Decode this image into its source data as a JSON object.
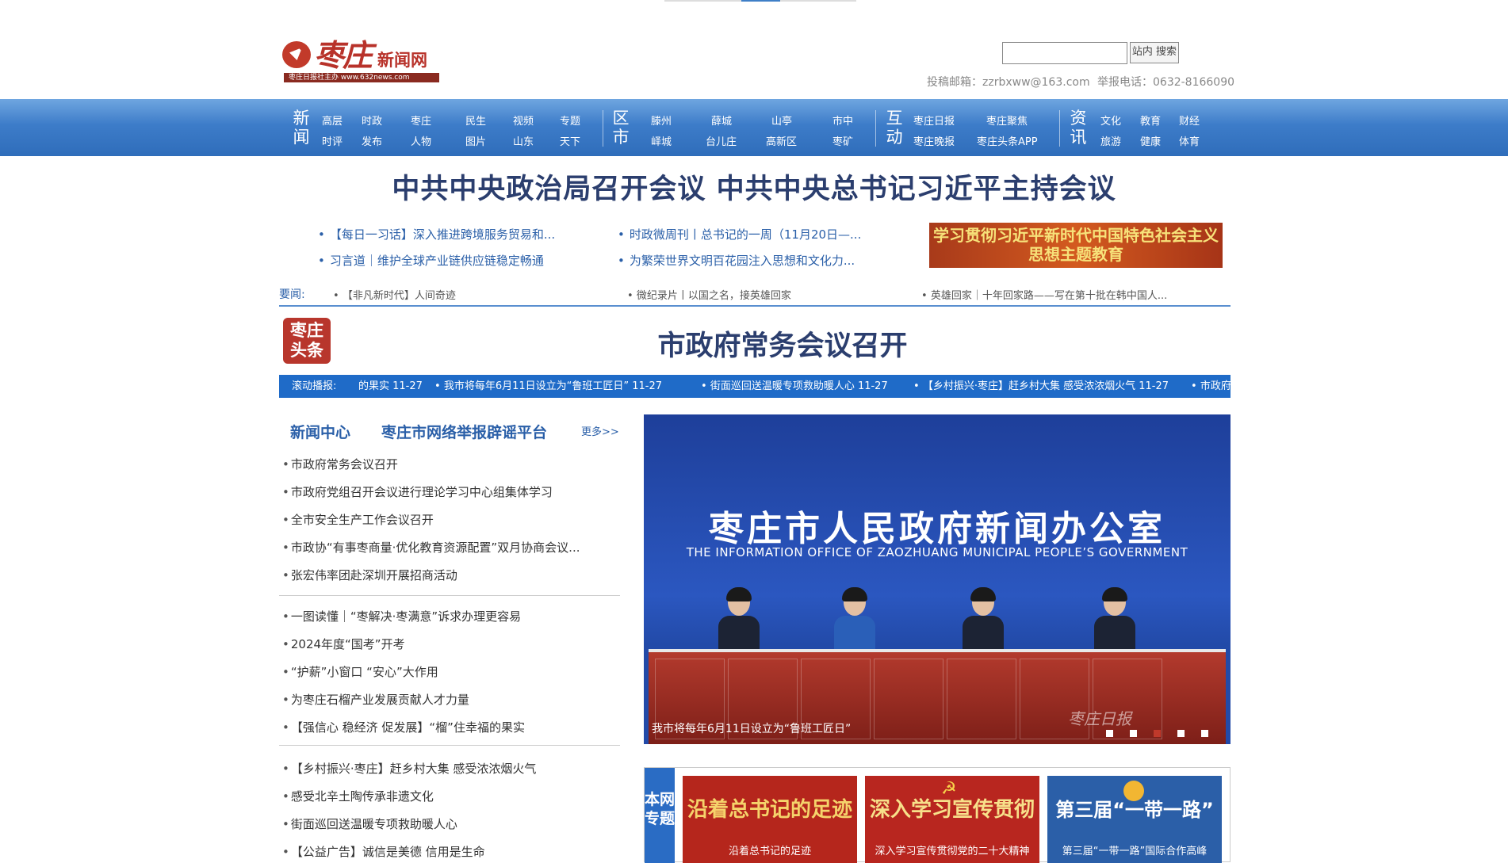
{
  "header": {
    "logo_name": "枣庄",
    "logo_subtitle": "新闻网",
    "logo_tagline": "枣庄日报社主办  www.632news.com",
    "search_button": "站内 搜索",
    "search_value": "",
    "email_text": "投稿邮箱：zzrbxww@163.com",
    "phone_text": "举报电话：0632-8166090"
  },
  "nav": {
    "groups": [
      {
        "big": "新闻",
        "items": [
          "高层",
          "时政",
          "枣庄",
          "民生",
          "视频",
          "专题",
          "时评",
          "发布",
          "人物",
          "图片",
          "山东",
          "天下"
        ]
      },
      {
        "big": "区市",
        "items": [
          "滕州",
          "薛城",
          "山亭",
          "市中",
          "峄城",
          "台儿庄",
          "高新区",
          "枣矿"
        ]
      },
      {
        "big": "互动",
        "items": [
          "枣庄日报",
          "枣庄聚焦",
          "枣庄晚报",
          "枣庄头条APP"
        ]
      },
      {
        "big": "资讯",
        "items": [
          "文化",
          "教育",
          "财经",
          "旅游",
          "健康",
          "体育"
        ]
      }
    ]
  },
  "headline": "中共中央政治局召开会议 中共中央总书记习近平主持会议",
  "sublinks": [
    "【每日一习话】深入推进跨境服务贸易和...",
    "时政微周刊丨总书记的一周（11月20日—...",
    "习言道｜维护全球产业链供应链稳定畅通",
    "为繁荣世界文明百花园注入思想和文化力..."
  ],
  "banner": "学习贯彻习近平新时代中国特色社会主义思想主题教育",
  "yaowen": {
    "label": "要闻:",
    "items": [
      "【非凡新时代】人间奇迹",
      "微纪录片丨以国之名，接英雄回家",
      "英雄回家｜十年回家路——写在第十批在韩中国人..."
    ]
  },
  "toutiao": {
    "badge": "枣庄头条",
    "title": "市政府常务会议召开"
  },
  "ticker": {
    "label": "滚动播报:",
    "items": [
      "的果实 11-27",
      "我市将每年6月11日设立为“鲁班工匠日” 11-27",
      "街面巡回送温暖专项救助暖人心 11-27",
      "【乡村振兴·枣庄】赶乡村大集 感受浓浓烟火气 11-27",
      "市政府"
    ]
  },
  "news_center": {
    "tab1": "新闻中心",
    "tab2": "枣庄市网络举报辟谣平台",
    "more": "更多>>",
    "group1": [
      "市政府常务会议召开",
      "市政府党组召开会议进行理论学习中心组集体学习",
      "全市安全生产工作会议召开",
      "市政协“有事枣商量·优化教育资源配置”双月协商会议...",
      "张宏伟率团赴深圳开展招商活动"
    ],
    "group2": [
      "一图读懂｜“枣解决·枣满意”诉求办理更容易",
      "2024年度“国考”开考",
      "“护薪”小窗口 “安心”大作用",
      "为枣庄石榴产业发展贡献人才力量",
      "【强信心 稳经济 促发展】“榴”住幸福的果实"
    ],
    "group3": [
      "【乡村振兴·枣庄】赶乡村大集 感受浓浓烟火气",
      "感受北辛土陶传承非遗文化",
      "街面巡回送温暖专项救助暖人心",
      "【公益广告】诚信是美德 信用是生命"
    ]
  },
  "slide": {
    "title_cn": "枣庄市人民政府新闻办公室",
    "title_en": "THE INFORMATION OFFICE OF ZAOZHUANG MUNICIPAL PEOPLE’S GOVERNMENT",
    "caption": "我市将每年6月11日设立为“鲁班工匠日”",
    "watermark": "枣庄日报",
    "active_dot": 3,
    "dot_count": 5
  },
  "topics": {
    "label": "本网专题",
    "cards": [
      {
        "big": "沿着总书记的足迹",
        "small": "沿着总书记的足迹",
        "bg": "#b5261c",
        "fg": "#f5d36b"
      },
      {
        "big": "深入学习宣传贯彻",
        "small": "深入学习宣传贯彻党的二十大精神",
        "bg": "#b8261f",
        "fg": "#f7e08a"
      },
      {
        "big": "第三届“一带一路”",
        "small": "第三届“一带一路”国际合作高峰",
        "bg": "#2b5fa8",
        "fg": "#ffffff"
      }
    ]
  },
  "colors": {
    "brand_red": "#b8322a",
    "nav_blue": "#3d7cc9",
    "link_blue": "#2a5fa8",
    "title_navy": "#2b3e6e"
  }
}
